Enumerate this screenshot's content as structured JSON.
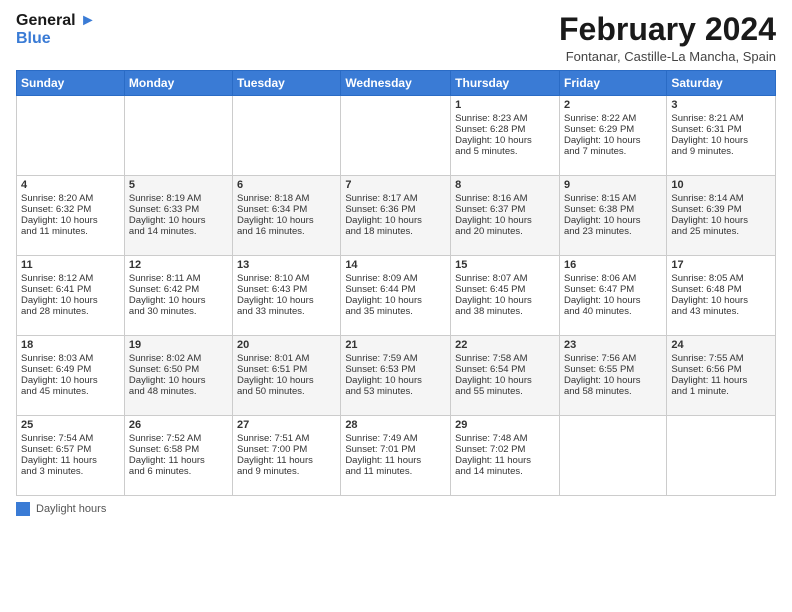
{
  "logo": {
    "line1": "General",
    "line2": "Blue"
  },
  "title": "February 2024",
  "location": "Fontanar, Castille-La Mancha, Spain",
  "days_of_week": [
    "Sunday",
    "Monday",
    "Tuesday",
    "Wednesday",
    "Thursday",
    "Friday",
    "Saturday"
  ],
  "weeks": [
    [
      {
        "num": "",
        "info": ""
      },
      {
        "num": "",
        "info": ""
      },
      {
        "num": "",
        "info": ""
      },
      {
        "num": "",
        "info": ""
      },
      {
        "num": "1",
        "info": "Sunrise: 8:23 AM\nSunset: 6:28 PM\nDaylight: 10 hours\nand 5 minutes."
      },
      {
        "num": "2",
        "info": "Sunrise: 8:22 AM\nSunset: 6:29 PM\nDaylight: 10 hours\nand 7 minutes."
      },
      {
        "num": "3",
        "info": "Sunrise: 8:21 AM\nSunset: 6:31 PM\nDaylight: 10 hours\nand 9 minutes."
      }
    ],
    [
      {
        "num": "4",
        "info": "Sunrise: 8:20 AM\nSunset: 6:32 PM\nDaylight: 10 hours\nand 11 minutes."
      },
      {
        "num": "5",
        "info": "Sunrise: 8:19 AM\nSunset: 6:33 PM\nDaylight: 10 hours\nand 14 minutes."
      },
      {
        "num": "6",
        "info": "Sunrise: 8:18 AM\nSunset: 6:34 PM\nDaylight: 10 hours\nand 16 minutes."
      },
      {
        "num": "7",
        "info": "Sunrise: 8:17 AM\nSunset: 6:36 PM\nDaylight: 10 hours\nand 18 minutes."
      },
      {
        "num": "8",
        "info": "Sunrise: 8:16 AM\nSunset: 6:37 PM\nDaylight: 10 hours\nand 20 minutes."
      },
      {
        "num": "9",
        "info": "Sunrise: 8:15 AM\nSunset: 6:38 PM\nDaylight: 10 hours\nand 23 minutes."
      },
      {
        "num": "10",
        "info": "Sunrise: 8:14 AM\nSunset: 6:39 PM\nDaylight: 10 hours\nand 25 minutes."
      }
    ],
    [
      {
        "num": "11",
        "info": "Sunrise: 8:12 AM\nSunset: 6:41 PM\nDaylight: 10 hours\nand 28 minutes."
      },
      {
        "num": "12",
        "info": "Sunrise: 8:11 AM\nSunset: 6:42 PM\nDaylight: 10 hours\nand 30 minutes."
      },
      {
        "num": "13",
        "info": "Sunrise: 8:10 AM\nSunset: 6:43 PM\nDaylight: 10 hours\nand 33 minutes."
      },
      {
        "num": "14",
        "info": "Sunrise: 8:09 AM\nSunset: 6:44 PM\nDaylight: 10 hours\nand 35 minutes."
      },
      {
        "num": "15",
        "info": "Sunrise: 8:07 AM\nSunset: 6:45 PM\nDaylight: 10 hours\nand 38 minutes."
      },
      {
        "num": "16",
        "info": "Sunrise: 8:06 AM\nSunset: 6:47 PM\nDaylight: 10 hours\nand 40 minutes."
      },
      {
        "num": "17",
        "info": "Sunrise: 8:05 AM\nSunset: 6:48 PM\nDaylight: 10 hours\nand 43 minutes."
      }
    ],
    [
      {
        "num": "18",
        "info": "Sunrise: 8:03 AM\nSunset: 6:49 PM\nDaylight: 10 hours\nand 45 minutes."
      },
      {
        "num": "19",
        "info": "Sunrise: 8:02 AM\nSunset: 6:50 PM\nDaylight: 10 hours\nand 48 minutes."
      },
      {
        "num": "20",
        "info": "Sunrise: 8:01 AM\nSunset: 6:51 PM\nDaylight: 10 hours\nand 50 minutes."
      },
      {
        "num": "21",
        "info": "Sunrise: 7:59 AM\nSunset: 6:53 PM\nDaylight: 10 hours\nand 53 minutes."
      },
      {
        "num": "22",
        "info": "Sunrise: 7:58 AM\nSunset: 6:54 PM\nDaylight: 10 hours\nand 55 minutes."
      },
      {
        "num": "23",
        "info": "Sunrise: 7:56 AM\nSunset: 6:55 PM\nDaylight: 10 hours\nand 58 minutes."
      },
      {
        "num": "24",
        "info": "Sunrise: 7:55 AM\nSunset: 6:56 PM\nDaylight: 11 hours\nand 1 minute."
      }
    ],
    [
      {
        "num": "25",
        "info": "Sunrise: 7:54 AM\nSunset: 6:57 PM\nDaylight: 11 hours\nand 3 minutes."
      },
      {
        "num": "26",
        "info": "Sunrise: 7:52 AM\nSunset: 6:58 PM\nDaylight: 11 hours\nand 6 minutes."
      },
      {
        "num": "27",
        "info": "Sunrise: 7:51 AM\nSunset: 7:00 PM\nDaylight: 11 hours\nand 9 minutes."
      },
      {
        "num": "28",
        "info": "Sunrise: 7:49 AM\nSunset: 7:01 PM\nDaylight: 11 hours\nand 11 minutes."
      },
      {
        "num": "29",
        "info": "Sunrise: 7:48 AM\nSunset: 7:02 PM\nDaylight: 11 hours\nand 14 minutes."
      },
      {
        "num": "",
        "info": ""
      },
      {
        "num": "",
        "info": ""
      }
    ]
  ],
  "legend": {
    "label": "Daylight hours"
  },
  "colors": {
    "header_bg": "#3a7bd5",
    "logo_blue": "#3a7bd5"
  }
}
